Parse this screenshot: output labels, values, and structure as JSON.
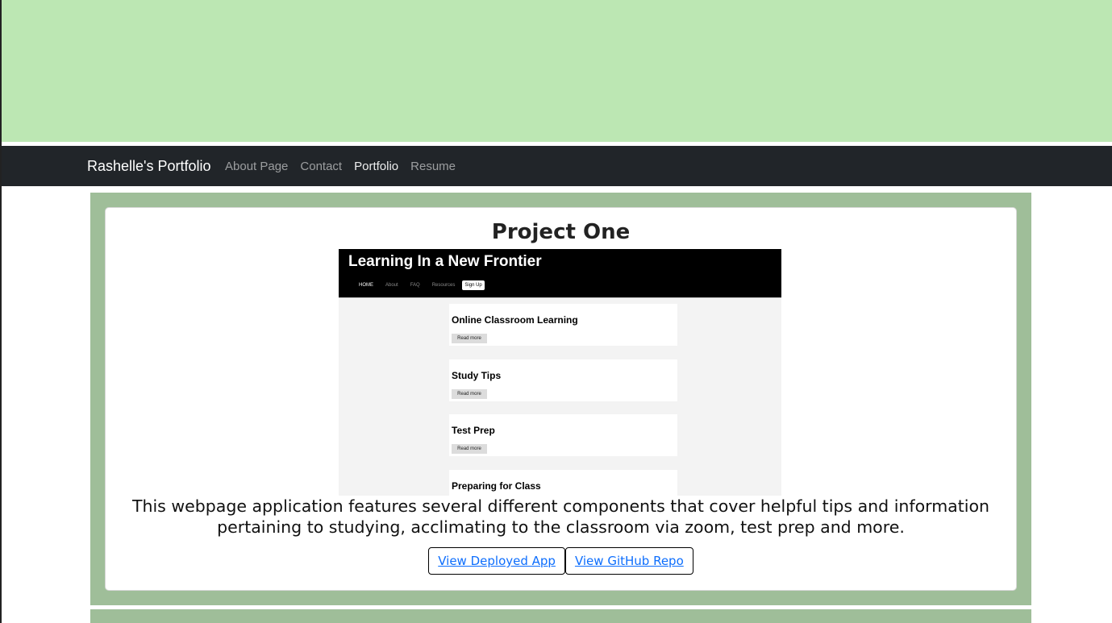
{
  "colors": {
    "hero_banner": "#bce7b3",
    "navbar": "#212529",
    "section_bg": "#9fbe99",
    "link": "#0d6efd"
  },
  "navbar": {
    "brand": "Rashelle's Portfolio",
    "links": [
      {
        "label": "About Page",
        "active": false
      },
      {
        "label": "Contact",
        "active": false
      },
      {
        "label": "Portfolio",
        "active": true
      },
      {
        "label": "Resume",
        "active": false
      }
    ]
  },
  "project": {
    "title": "Project One",
    "thumbnail": {
      "site_title": "Learning In a New Frontier",
      "nav": [
        "HOME",
        "About",
        "FAQ",
        "Resources"
      ],
      "signup": "Sign Up",
      "cards": [
        {
          "title": "Online Classroom Learning",
          "button": "Read more"
        },
        {
          "title": "Study Tips",
          "button": "Read more"
        },
        {
          "title": "Test Prep",
          "button": "Read more"
        },
        {
          "title": "Preparing for Class"
        }
      ]
    },
    "description": "This webpage application features several different components that cover helpful tips and information pertaining to studying, acclimating to the classroom via zoom, test prep and more.",
    "buttons": {
      "deployed": "View Deployed App",
      "repo": "View GitHub Repo"
    }
  }
}
